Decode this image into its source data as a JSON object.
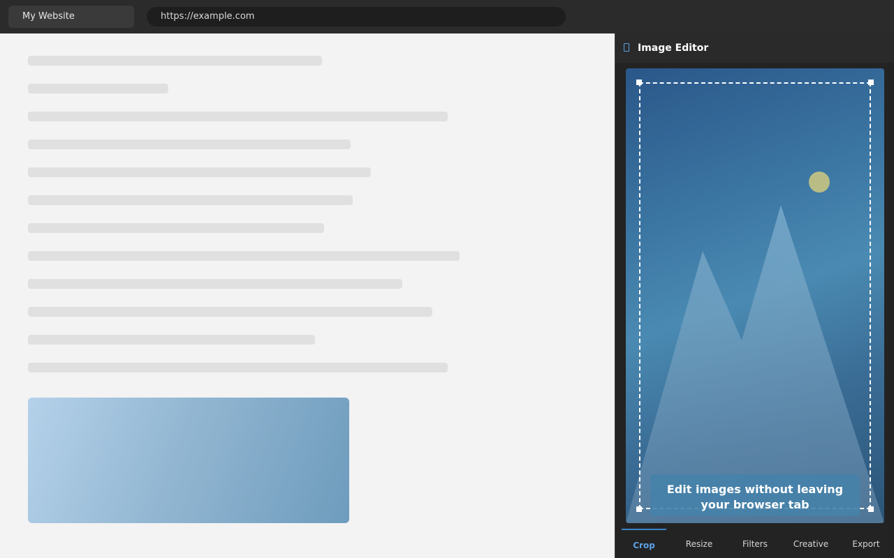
{
  "browser": {
    "tab_title": "My Website",
    "url": "https://example.com"
  },
  "panel": {
    "title": "Image Editor",
    "icon": "image-editor-icon",
    "caption": "Edit images without leaving your browser tab",
    "tabs": [
      {
        "label": "Crop",
        "active": true
      },
      {
        "label": "Resize",
        "active": false
      },
      {
        "label": "Filters",
        "active": false
      },
      {
        "label": "Creative",
        "active": false
      },
      {
        "label": "Export",
        "active": false
      }
    ]
  },
  "colors": {
    "accent": "#3a85c9",
    "panel_bg": "#232323",
    "page_bg": "#f3f3f3"
  }
}
